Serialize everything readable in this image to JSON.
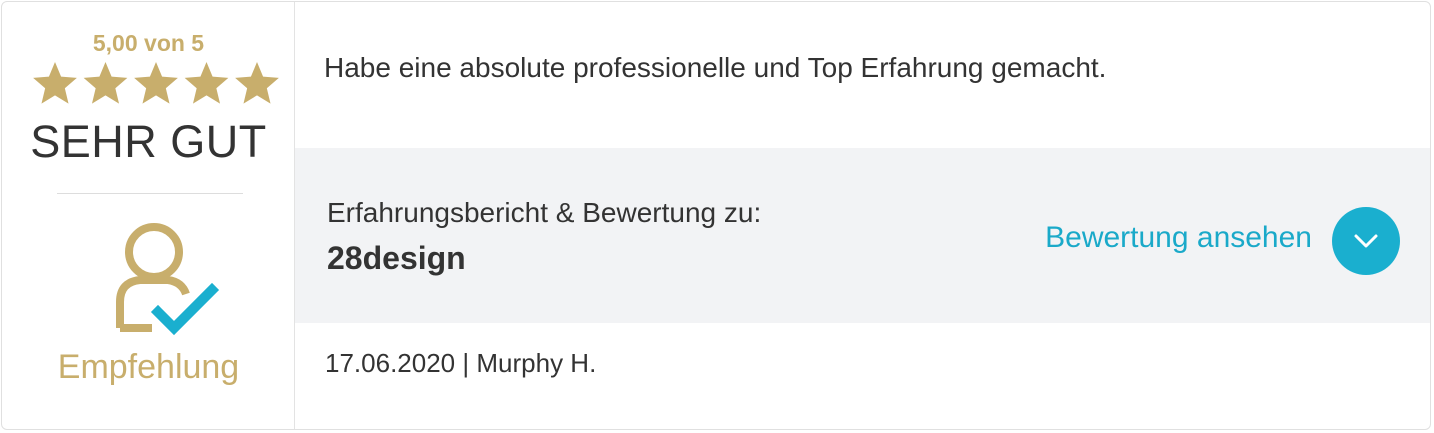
{
  "rating": {
    "score_label": "5,00 von 5",
    "stars_filled": 5,
    "stars_total": 5,
    "verdict": "SEHR GUT",
    "recommendation": "Empfehlung"
  },
  "review": {
    "text": "Habe eine absolute professionelle und Top Erfahrung gemacht.",
    "subject_label": "Erfahrungsbericht & Bewertung zu:",
    "company": "28design",
    "view_link": "Bewertung ansehen",
    "date": "17.06.2020",
    "separator": "|",
    "author": "Murphy H."
  },
  "colors": {
    "gold": "#c8ae6c",
    "accent": "#1aafcf",
    "band_bg": "#f2f3f5",
    "text": "#333333"
  },
  "icons": {
    "star": "star-icon",
    "recommendation": "user-check-icon",
    "toggle": "chevron-down-icon"
  }
}
